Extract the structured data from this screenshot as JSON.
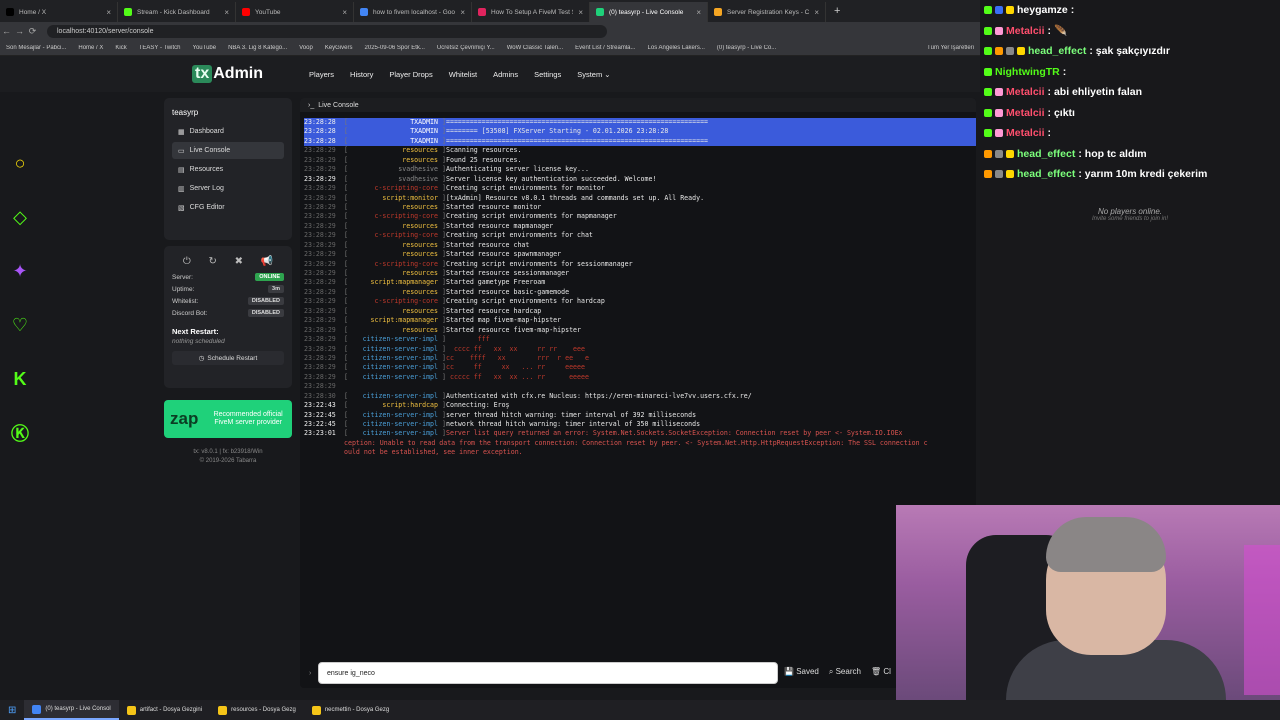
{
  "browser": {
    "tabs": [
      {
        "title": "Home / X",
        "color": "#000000"
      },
      {
        "title": "Stream - Kick Dashboard",
        "color": "#53fc18"
      },
      {
        "title": "YouTube",
        "color": "#ff0000"
      },
      {
        "title": "how to fivem localhost - Google",
        "color": "#4285f4"
      },
      {
        "title": "How To Setup A FiveM Test Server",
        "color": "#e0245e"
      },
      {
        "title": "(0) teasyrp - Live Console",
        "color": "#1fd17a"
      },
      {
        "title": "Server Registration Keys - Cfx.re",
        "color": "#f5a623"
      }
    ],
    "active_tab": 5,
    "url": "localhost:40120/server/console",
    "bookmarks": [
      "Son Mesajlar - Pabci...",
      "Home / X",
      "Kick",
      "TEASY - Twitch",
      "YouTube",
      "NBA 3. Lig 8 Katego...",
      "Voop",
      "KeyGivers",
      "2025-09-06 Spor Etk...",
      "Ücretsiz Çevrimiçi Y...",
      "WoW Classic Talen...",
      "Event List / Streamla...",
      "Los Angeles Lakers...",
      "(0) teasyrp - Live Co..."
    ],
    "all_bookmarks": "Tüm Yer İşaretleri"
  },
  "txadmin": {
    "logo_tx": "tx",
    "logo_admin": "Admin",
    "menu": [
      "Players",
      "History",
      "Player Drops",
      "Whitelist",
      "Admins",
      "Settings",
      "System ⌄"
    ],
    "server_name": "teasyrp",
    "sidebar": [
      {
        "label": "Dashboard",
        "icon": "▦"
      },
      {
        "label": "Live Console",
        "icon": "▭"
      },
      {
        "label": "Resources",
        "icon": "▤"
      },
      {
        "label": "Server Log",
        "icon": "▥"
      },
      {
        "label": "CFG Editor",
        "icon": "▧"
      }
    ],
    "status": [
      {
        "label": "Server:",
        "value": "ONLINE",
        "on": true
      },
      {
        "label": "Uptime:",
        "value": "3m",
        "on": false
      },
      {
        "label": "Whitelist:",
        "value": "DISABLED",
        "on": false
      },
      {
        "label": "Discord Bot:",
        "value": "DISABLED",
        "on": false
      }
    ],
    "next_restart": "Next Restart:",
    "next_restart_value": "nothing scheduled",
    "schedule_btn": "Schedule Restart",
    "zap_logo": "zap",
    "zap_text": "Recommended official FiveM server provider",
    "version": "tx: v8.0.1 | fx: b23918/Win",
    "copyright": "© 2019-2026 Tabarra",
    "console_title": "Live Console",
    "command_value": "ensure ig_neco",
    "buttons": {
      "saved": "Saved",
      "search": "Search",
      "clear": "Cl"
    }
  },
  "console_lines": [
    {
      "t": "23:28:28",
      "c": "TXADMIN",
      "cc": "#ffffff",
      "m": "==================================================================",
      "mc": "#e8e8e8",
      "hl": true
    },
    {
      "t": "23:28:28",
      "c": "TXADMIN",
      "cc": "#ffffff",
      "m": "======== [53508] FXServer Starting - 02.01.2026 23:28:28",
      "mc": "#e8e8e8",
      "hl": true
    },
    {
      "t": "23:28:28",
      "c": "TXADMIN",
      "cc": "#ffffff",
      "m": "==================================================================",
      "mc": "#e8e8e8",
      "hl": true
    },
    {
      "t": "23:28:29",
      "c": "resources",
      "cc": "#f0c040",
      "m": "Scanning resources.",
      "mc": "#e8e8e8"
    },
    {
      "t": "23:28:29",
      "c": "resources",
      "cc": "#f0c040",
      "m": "Found 25 resources.",
      "mc": "#e8e8e8"
    },
    {
      "t": "23:28:29",
      "c": "svadhesive",
      "cc": "#888888",
      "m": "Authenticating server license key...",
      "mc": "#e8e8e8"
    },
    {
      "t": "23:28:29",
      "c": "svadhesive",
      "cc": "#888888",
      "m": "Server license key authentication succeeded. Welcome!",
      "mc": "#e8e8e8",
      "tb": true
    },
    {
      "t": "23:28:29",
      "c": "c-scripting-core",
      "cc": "#c0392b",
      "m": "Creating script environments for monitor",
      "mc": "#e8e8e8"
    },
    {
      "t": "23:28:29",
      "c": "script:monitor",
      "cc": "#f0c040",
      "m": "[txAdmin] Resource v8.0.1 threads and commands set up. All Ready.",
      "mc": "#e8e8e8"
    },
    {
      "t": "23:28:29",
      "c": "resources",
      "cc": "#f0c040",
      "m": "Started resource monitor",
      "mc": "#e8e8e8"
    },
    {
      "t": "23:28:29",
      "c": "c-scripting-core",
      "cc": "#c0392b",
      "m": "Creating script environments for mapmanager",
      "mc": "#e8e8e8"
    },
    {
      "t": "23:28:29",
      "c": "resources",
      "cc": "#f0c040",
      "m": "Started resource mapmanager",
      "mc": "#e8e8e8"
    },
    {
      "t": "23:28:29",
      "c": "c-scripting-core",
      "cc": "#c0392b",
      "m": "Creating script environments for chat",
      "mc": "#e8e8e8"
    },
    {
      "t": "23:28:29",
      "c": "resources",
      "cc": "#f0c040",
      "m": "Started resource chat",
      "mc": "#e8e8e8"
    },
    {
      "t": "23:28:29",
      "c": "resources",
      "cc": "#f0c040",
      "m": "Started resource spawnmanager",
      "mc": "#e8e8e8"
    },
    {
      "t": "23:28:29",
      "c": "c-scripting-core",
      "cc": "#c0392b",
      "m": "Creating script environments for sessionmanager",
      "mc": "#e8e8e8"
    },
    {
      "t": "23:28:29",
      "c": "resources",
      "cc": "#f0c040",
      "m": "Started resource sessionmanager",
      "mc": "#e8e8e8"
    },
    {
      "t": "23:28:29",
      "c": "script:mapmanager",
      "cc": "#f0c040",
      "m": "Started gametype Freeroam",
      "mc": "#e8e8e8"
    },
    {
      "t": "23:28:29",
      "c": "resources",
      "cc": "#f0c040",
      "m": "Started resource basic-gamemode",
      "mc": "#e8e8e8"
    },
    {
      "t": "23:28:29",
      "c": "c-scripting-core",
      "cc": "#c0392b",
      "m": "Creating script environments for hardcap",
      "mc": "#e8e8e8"
    },
    {
      "t": "23:28:29",
      "c": "resources",
      "cc": "#f0c040",
      "m": "Started resource hardcap",
      "mc": "#e8e8e8"
    },
    {
      "t": "23:28:29",
      "c": "script:mapmanager",
      "cc": "#f0c040",
      "m": "Started map fivem-map-hipster",
      "mc": "#e8e8e8"
    },
    {
      "t": "23:28:29",
      "c": "resources",
      "cc": "#f0c040",
      "m": "Started resource fivem-map-hipster",
      "mc": "#e8e8e8"
    },
    {
      "t": "23:28:29",
      "c": "citizen-server-impl",
      "cc": "#4a9fd8",
      "m": "        fff",
      "mc": "#c0392b"
    },
    {
      "t": "23:28:29",
      "c": "citizen-server-impl",
      "cc": "#4a9fd8",
      "m": "  cccc ff   xx  xx     rr rr    eee",
      "mc": "#c0392b"
    },
    {
      "t": "23:28:29",
      "c": "citizen-server-impl",
      "cc": "#4a9fd8",
      "m": "cc    ffff   xx        rrr  r ee   e",
      "mc": "#c0392b"
    },
    {
      "t": "23:28:29",
      "c": "citizen-server-impl",
      "cc": "#4a9fd8",
      "m": "cc     ff     xx   ... rr     eeeee",
      "mc": "#c0392b"
    },
    {
      "t": "23:28:29",
      "c": "citizen-server-impl",
      "cc": "#4a9fd8",
      "m": " ccccc ff   xx  xx ... rr      eeeee",
      "mc": "#c0392b"
    },
    {
      "t": "23:28:29",
      "c": "",
      "cc": "#4a9fd8",
      "m": "",
      "mc": "#e8e8e8"
    },
    {
      "t": "23:28:30",
      "c": "citizen-server-impl",
      "cc": "#4a9fd8",
      "m": "Authenticated with cfx.re Nucleus: https://eren-minareci-lve7vv.users.cfx.re/",
      "mc": "#e8e8e8"
    },
    {
      "t": "23:22:43",
      "c": "script:hardcap",
      "cc": "#f0c040",
      "m": "Connecting: Eroş",
      "mc": "#e8e8e8",
      "tb": true
    },
    {
      "t": "23:22:45",
      "c": "citizen-server-impl",
      "cc": "#4a9fd8",
      "m": "server thread hitch warning: timer interval of 392 milliseconds",
      "mc": "#e8e8e8",
      "tb": true
    },
    {
      "t": "23:22:45",
      "c": "citizen-server-impl",
      "cc": "#4a9fd8",
      "m": "network thread hitch warning: timer interval of 350 milliseconds",
      "mc": "#e8e8e8",
      "tb": true
    },
    {
      "t": "23:23:01",
      "c": "citizen-server-impl",
      "cc": "#4a9fd8",
      "m": "Server list query returned an error: System.Net.Sockets.SocketException: Connection reset by peer <- System.IO.IOEx",
      "mc": "#d9534f",
      "tb": true
    },
    {
      "t": "",
      "c": "",
      "cc": "#4a9fd8",
      "m": "ception: Unable to read data from the transport connection: Connection reset by peer. <- System.Net.Http.HttpRequestException: The SSL connection c",
      "mc": "#d9534f",
      "raw": true
    },
    {
      "t": "",
      "c": "",
      "cc": "#4a9fd8",
      "m": "ould not be established, see inner exception.",
      "mc": "#d9534f",
      "raw": true
    }
  ],
  "chat": {
    "messages": [
      {
        "user": "heygamze",
        "color": "#ffffff",
        "text": "",
        "badges": [
          "#53fc18",
          "#3a6ff7",
          "#ffd700"
        ]
      },
      {
        "user": "Metalcii",
        "color": "#ff4f6e",
        "text": "🪶",
        "badges": [
          "#53fc18",
          "#ff9ad5"
        ]
      },
      {
        "user": "head_effect",
        "color": "#7cff7c",
        "text": "şak şakçıyızdır",
        "badges": [
          "#53fc18",
          "#ff9900",
          "#888888",
          "#ffd700"
        ]
      },
      {
        "user": "NightwingTR",
        "color": "#53fc18",
        "text": "",
        "badges": [
          "#53fc18"
        ]
      },
      {
        "user": "Metalcii",
        "color": "#ff4f6e",
        "text": "abi ehliyetin falan",
        "badges": [
          "#53fc18",
          "#ff9ad5"
        ]
      },
      {
        "user": "Metalcii",
        "color": "#ff4f6e",
        "text": "çıktı",
        "badges": [
          "#53fc18",
          "#ff9ad5"
        ]
      },
      {
        "user": "Metalcii",
        "color": "#ff4f6e",
        "text": "",
        "badges": [
          "#53fc18",
          "#ff9ad5"
        ]
      },
      {
        "user": "head_effect",
        "color": "#7cff7c",
        "text": "hop tc aldım",
        "badges": [
          "#ff9900",
          "#888888",
          "#ffd700"
        ]
      },
      {
        "user": "head_effect",
        "color": "#7cff7c",
        "text": "yarım 10m kredi çekerim",
        "badges": [
          "#ff9900",
          "#888888",
          "#ffd700"
        ]
      }
    ],
    "no_players": "No players online.",
    "invite": "Invite some friends to join in!"
  },
  "taskbar": [
    {
      "label": "(0) teasyrp - Live Consol",
      "color": "#4285f4",
      "active": true
    },
    {
      "label": "artifact - Dosya Gezgini",
      "color": "#f5c518"
    },
    {
      "label": "resources - Dosya Gezg",
      "color": "#f5c518"
    },
    {
      "label": "necmettin - Dosya Gezg",
      "color": "#f5c518"
    }
  ]
}
